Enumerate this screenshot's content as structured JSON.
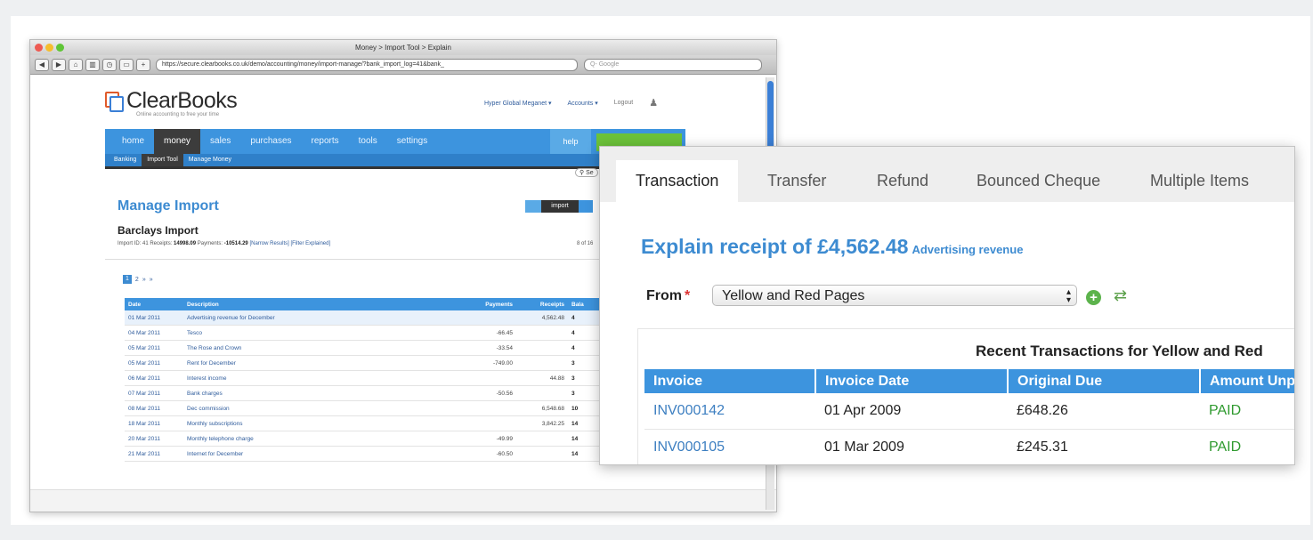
{
  "browser": {
    "title": "Money > Import Tool > Explain",
    "url": "https://secure.clearbooks.co.uk/demo/accounting/money/import-manage/?bank_import_log=41&bank_",
    "search_placeholder": "Q- Google"
  },
  "app": {
    "logo": "ClearBooks",
    "tagline": "Online accounting to free your time",
    "company": "Hyper Global Meganet ▾",
    "accounts": "Accounts ▾",
    "logout": "Logout"
  },
  "nav": {
    "main": [
      "home",
      "money",
      "sales",
      "purchases",
      "reports",
      "tools",
      "settings"
    ],
    "sub": [
      "Banking",
      "Import Tool",
      "Manage Money"
    ],
    "help": "help",
    "search": "Se"
  },
  "manage": {
    "title": "Manage Import",
    "import_button": "import",
    "account_title": "Barclays Import",
    "meta_prefix": "Import ID: 41 Receipts: ",
    "receipts": "14998.09",
    "meta_payments": " Payments: ",
    "payments": "-10514.29",
    "links": " [Narrow Results] [Filter Explained]",
    "count": "8 of 16",
    "pages": [
      "1",
      "2",
      "»",
      "»"
    ]
  },
  "import_table": {
    "headers": [
      "Date",
      "Description",
      "Payments",
      "Receipts",
      "Bala"
    ],
    "rows": [
      {
        "date": "01 Mar 2011",
        "desc": "Advertising revenue for December",
        "pay": "",
        "rec": "4,562.48",
        "bal": "4"
      },
      {
        "date": "04 Mar 2011",
        "desc": "Tesco",
        "pay": "-66.45",
        "rec": "",
        "bal": "4"
      },
      {
        "date": "05 Mar 2011",
        "desc": "The Rose and Crown",
        "pay": "-33.54",
        "rec": "",
        "bal": "4"
      },
      {
        "date": "05 Mar 2011",
        "desc": "Rent for December",
        "pay": "-749.00",
        "rec": "",
        "bal": "3"
      },
      {
        "date": "06 Mar 2011",
        "desc": "Interest income",
        "pay": "",
        "rec": "44.88",
        "bal": "3"
      },
      {
        "date": "07 Mar 2011",
        "desc": "Bank charges",
        "pay": "-50.56",
        "rec": "",
        "bal": "3"
      },
      {
        "date": "08 Mar 2011",
        "desc": "Dec commission",
        "pay": "",
        "rec": "6,548.68",
        "bal": "10"
      },
      {
        "date": "18 Mar 2011",
        "desc": "Monthly subscriptions",
        "pay": "",
        "rec": "3,842.25",
        "bal": "14"
      },
      {
        "date": "20 Mar 2011",
        "desc": "Monthly telephone charge",
        "pay": "-49.99",
        "rec": "",
        "bal": "14"
      },
      {
        "date": "21 Mar 2011",
        "desc": "Internet for December",
        "pay": "-60.50",
        "rec": "",
        "bal": "14"
      }
    ]
  },
  "popup": {
    "tabs": [
      "Transaction",
      "Transfer",
      "Refund",
      "Bounced Cheque",
      "Multiple Items"
    ],
    "explain_title": "Explain receipt of £4,562.48",
    "explain_sub": "Advertising revenue",
    "from_label": "From",
    "required_mark": "*",
    "from_value": "Yellow and Red Pages",
    "recent_title": "Recent Transactions for Yellow and Red",
    "table_headers": [
      "Invoice",
      "Invoice Date",
      "Original Due",
      "Amount Unpa"
    ],
    "rows": [
      {
        "invoice": "INV000142",
        "date": "01 Apr 2009",
        "due": "£648.26",
        "status": "PAID"
      },
      {
        "invoice": "INV000105",
        "date": "01 Mar 2009",
        "due": "£245.31",
        "status": "PAID"
      }
    ]
  },
  "colors": {
    "accent": "#3d94de",
    "brand_orange": "#e05a2a",
    "paid": "#2f9a2f",
    "add_green": "#5cb34c"
  }
}
